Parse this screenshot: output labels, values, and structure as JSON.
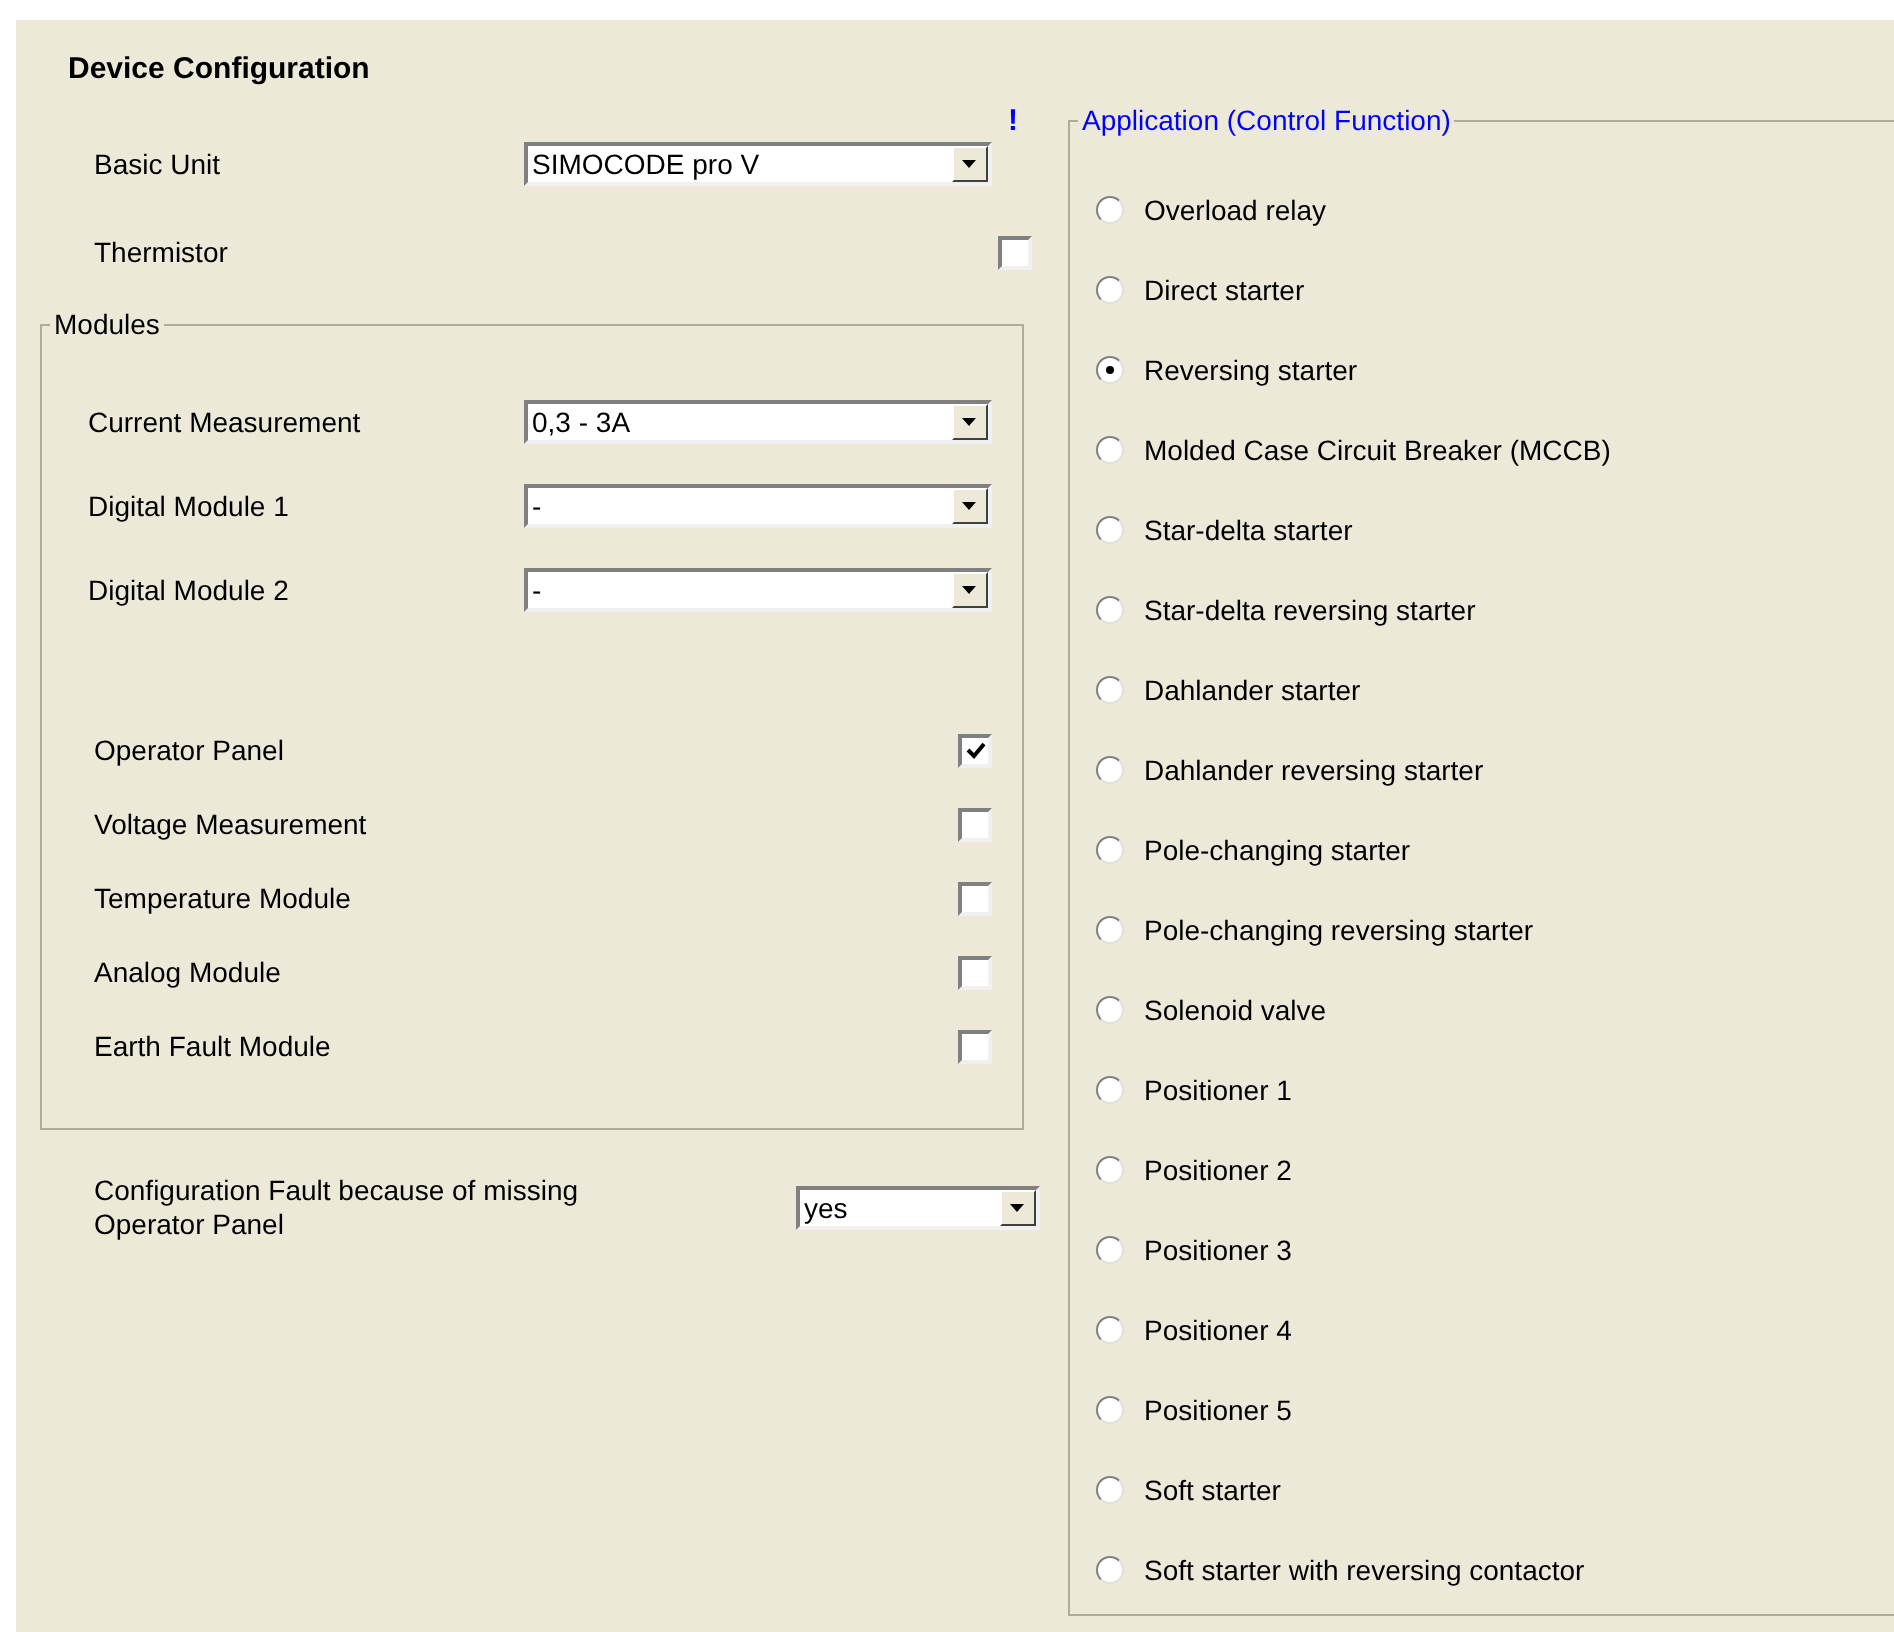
{
  "title": "Device Configuration",
  "basic_unit": {
    "label": "Basic Unit",
    "value": "SIMOCODE pro V"
  },
  "thermistor": {
    "label": "Thermistor",
    "checked": false
  },
  "modules": {
    "legend": "Modules",
    "dropdowns": [
      {
        "label": "Current Measurement",
        "value": "0,3 - 3A"
      },
      {
        "label": "Digital Module 1",
        "value": "-"
      },
      {
        "label": "Digital Module 2",
        "value": "-"
      }
    ],
    "checkboxes": [
      {
        "label": "Operator Panel",
        "checked": true
      },
      {
        "label": "Voltage Measurement",
        "checked": false
      },
      {
        "label": "Temperature Module",
        "checked": false
      },
      {
        "label": "Analog Module",
        "checked": false
      },
      {
        "label": "Earth Fault Module",
        "checked": false
      }
    ]
  },
  "config_fault": {
    "label": "Configuration Fault because of missing Operator Panel",
    "value": "yes"
  },
  "warning_mark": "!",
  "application": {
    "legend": "Application (Control Function)",
    "options": [
      {
        "label": "Overload relay",
        "selected": false
      },
      {
        "label": "Direct starter",
        "selected": false
      },
      {
        "label": "Reversing starter",
        "selected": true
      },
      {
        "label": "Molded Case Circuit Breaker (MCCB)",
        "selected": false
      },
      {
        "label": "Star-delta starter",
        "selected": false
      },
      {
        "label": "Star-delta reversing starter",
        "selected": false
      },
      {
        "label": "Dahlander starter",
        "selected": false
      },
      {
        "label": "Dahlander reversing starter",
        "selected": false
      },
      {
        "label": "Pole-changing starter",
        "selected": false
      },
      {
        "label": "Pole-changing reversing starter",
        "selected": false
      },
      {
        "label": "Solenoid valve",
        "selected": false
      },
      {
        "label": "Positioner 1",
        "selected": false
      },
      {
        "label": "Positioner 2",
        "selected": false
      },
      {
        "label": "Positioner 3",
        "selected": false
      },
      {
        "label": "Positioner 4",
        "selected": false
      },
      {
        "label": "Positioner 5",
        "selected": false
      },
      {
        "label": "Soft starter",
        "selected": false
      },
      {
        "label": "Soft starter with reversing contactor",
        "selected": false
      }
    ]
  }
}
